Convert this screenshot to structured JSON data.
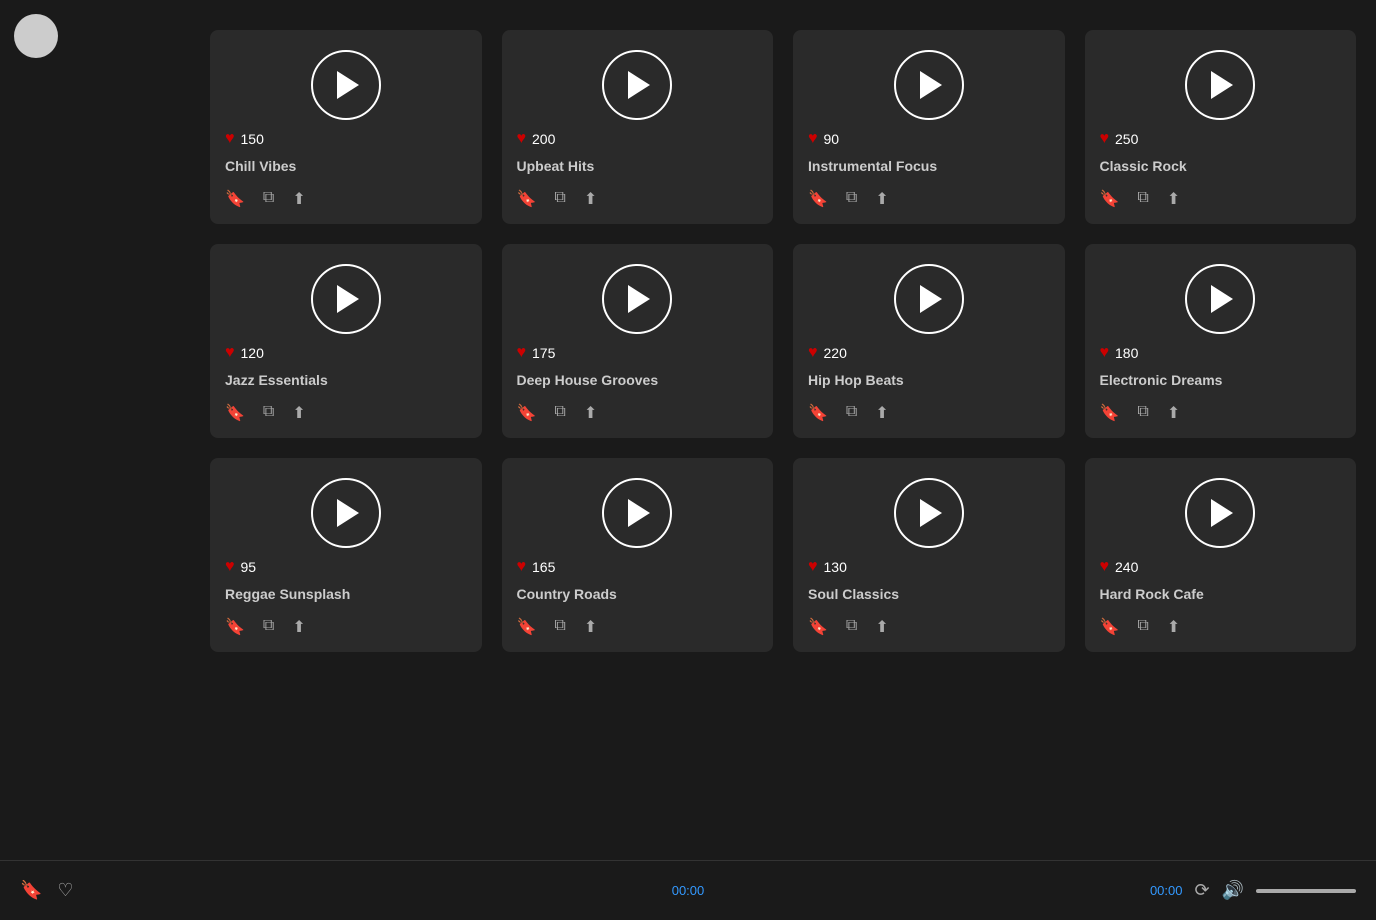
{
  "avatar": {
    "label": "User Avatar"
  },
  "playlists": [
    {
      "id": 1,
      "title": "Chill Vibes",
      "likes": 150
    },
    {
      "id": 2,
      "title": "Upbeat Hits",
      "likes": 200
    },
    {
      "id": 3,
      "title": "Instrumental Focus",
      "likes": 90
    },
    {
      "id": 4,
      "title": "Classic Rock",
      "likes": 250
    },
    {
      "id": 5,
      "title": "Jazz Essentials",
      "likes": 120
    },
    {
      "id": 6,
      "title": "Deep House Grooves",
      "likes": 175
    },
    {
      "id": 7,
      "title": "Hip Hop Beats",
      "likes": 220
    },
    {
      "id": 8,
      "title": "Electronic Dreams",
      "likes": 180
    },
    {
      "id": 9,
      "title": "Reggae Sunsplash",
      "likes": 95
    },
    {
      "id": 10,
      "title": "Country Roads",
      "likes": 165
    },
    {
      "id": 11,
      "title": "Soul Classics",
      "likes": 130
    },
    {
      "id": 12,
      "title": "Hard Rock Cafe",
      "likes": 240
    }
  ],
  "player": {
    "time_left": "00:00",
    "time_right": "00:00",
    "volume_label": "Volume"
  }
}
